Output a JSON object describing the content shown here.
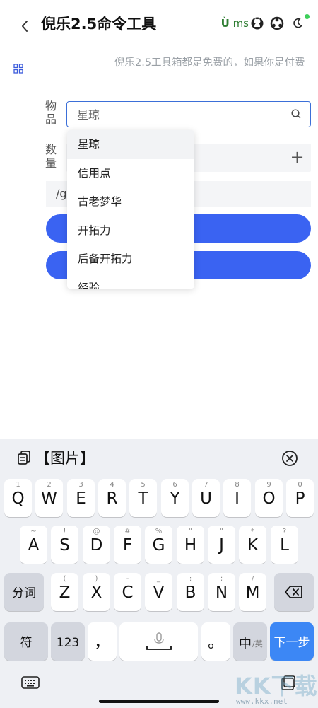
{
  "header": {
    "back_glyph": "‹",
    "title": "倪乐2.5命令工具",
    "ums_u": "Ù",
    "ums_text": " ms",
    "icons": [
      "github-icon",
      "community-icon",
      "moon-icon"
    ],
    "status_dot_color": "#3ecf5a"
  },
  "notice": {
    "text": "倪乐2.5工具箱都是免费的，如果你是付费"
  },
  "form": {
    "item_label": "物品",
    "item_input_value": "星琼",
    "qty_label": "数量",
    "plus_glyph": "+",
    "command_text": "/g"
  },
  "dropdown": {
    "options": [
      "星琼",
      "信用点",
      "古老梦华",
      "开拓力",
      "后备开拓力",
      "经验"
    ],
    "selected": "星琼"
  },
  "clipboard": {
    "text": "【图片】"
  },
  "keyboard": {
    "row1": [
      {
        "main": "Q",
        "sub": "1"
      },
      {
        "main": "W",
        "sub": "2"
      },
      {
        "main": "E",
        "sub": "3"
      },
      {
        "main": "R",
        "sub": "4"
      },
      {
        "main": "T",
        "sub": "5"
      },
      {
        "main": "Y",
        "sub": "6"
      },
      {
        "main": "U",
        "sub": "7"
      },
      {
        "main": "I",
        "sub": "8"
      },
      {
        "main": "O",
        "sub": "9"
      },
      {
        "main": "P",
        "sub": "0"
      }
    ],
    "row2": [
      {
        "main": "A",
        "sub": "~"
      },
      {
        "main": "S",
        "sub": "!"
      },
      {
        "main": "D",
        "sub": "@"
      },
      {
        "main": "F",
        "sub": "#"
      },
      {
        "main": "G",
        "sub": "%"
      },
      {
        "main": "H",
        "sub": "\""
      },
      {
        "main": "J",
        "sub": "\""
      },
      {
        "main": "K",
        "sub": "*"
      },
      {
        "main": "L",
        "sub": "?"
      }
    ],
    "row3": [
      {
        "main": "Z",
        "sub": "("
      },
      {
        "main": "X",
        "sub": ")"
      },
      {
        "main": "C",
        "sub": "-"
      },
      {
        "main": "V",
        "sub": "_"
      },
      {
        "main": "B",
        "sub": ":"
      },
      {
        "main": "N",
        "sub": ";"
      },
      {
        "main": "M",
        "sub": "/"
      }
    ],
    "fenci": "分词",
    "fu": "符",
    "num": "123",
    "comma": "，",
    "period": "。",
    "zh": "中",
    "en": "/英",
    "next": "下一步",
    "accent_color": "#3c87f5"
  },
  "watermark": {
    "text": "KK下载",
    "url": "www.kkx.net"
  }
}
